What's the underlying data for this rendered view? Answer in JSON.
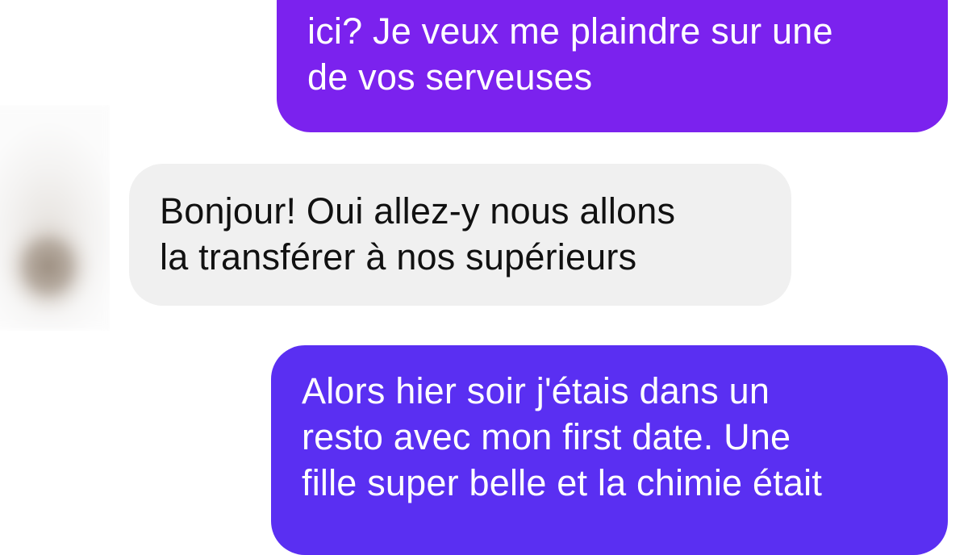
{
  "conversation": {
    "messages": [
      {
        "direction": "sent",
        "lines": [
          "ici? Je veux me plaindre sur une",
          "de vos serveuses"
        ]
      },
      {
        "direction": "received",
        "lines": [
          "Bonjour! Oui allez-y nous allons",
          "la transférer à nos supérieurs"
        ]
      },
      {
        "direction": "sent",
        "lines": [
          "Alors hier soir j'étais dans un",
          "resto avec mon first date. Une",
          "fille super belle et la chimie était"
        ]
      }
    ]
  },
  "colors": {
    "sent_bubble_top": "#7b22ee",
    "sent_bubble_bottom": "#5a2ff2",
    "received_bubble": "#f0f0f0",
    "received_text": "#111111",
    "sent_text": "#ffffff"
  }
}
